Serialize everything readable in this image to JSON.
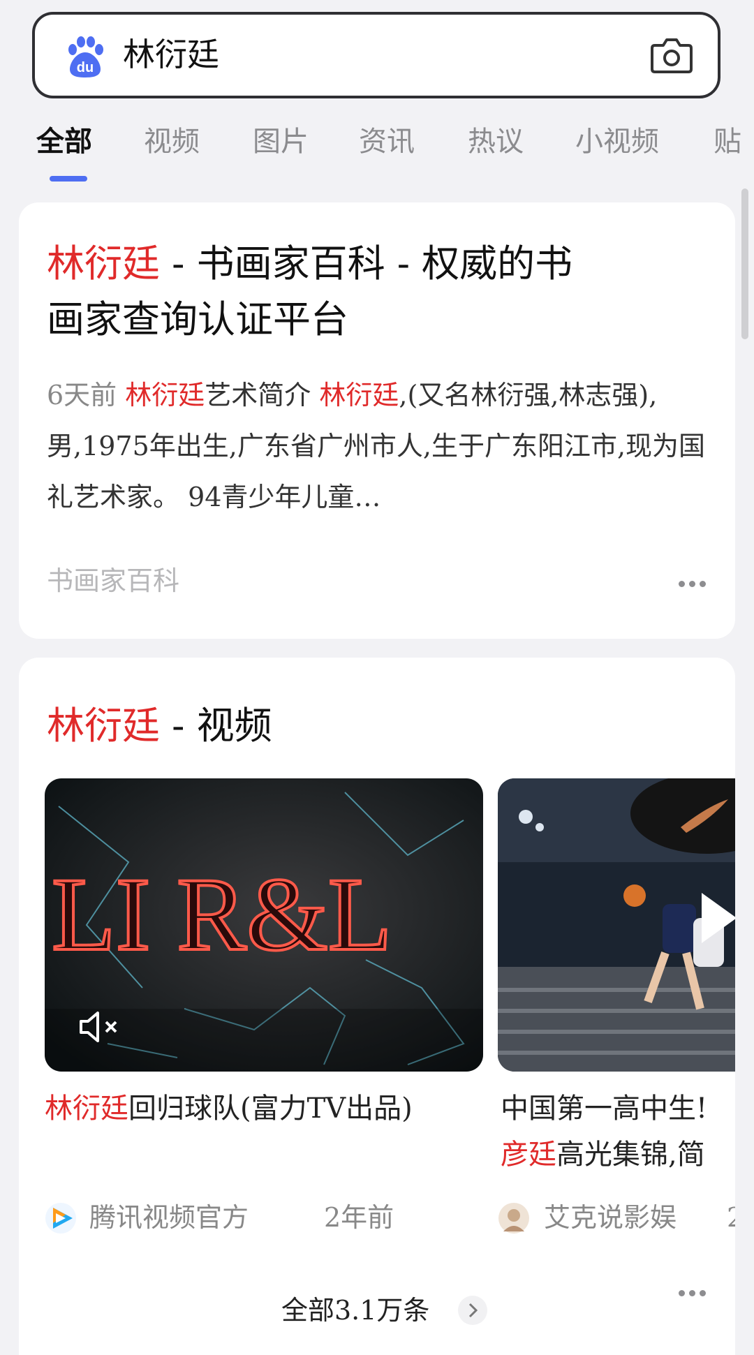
{
  "search": {
    "query": "林衍廷",
    "logo_text": "du"
  },
  "tabs": [
    {
      "label": "全部",
      "active": true
    },
    {
      "label": "视频"
    },
    {
      "label": "图片"
    },
    {
      "label": "资讯"
    },
    {
      "label": "热议"
    },
    {
      "label": "小视频"
    },
    {
      "label": "贴"
    }
  ],
  "result1": {
    "title_hl": "林衍廷",
    "title_rest1": " - 书画家百科 - 权威的书",
    "title_rest2": "画家查询认证平台",
    "date": "6天前",
    "abs_hl1": "林衍廷",
    "abs_t1": "艺术简介",
    "abs_hl2": "林衍廷",
    "abs_t2": ",(又名林衍强,林志强),男,1975年出生,广东省广州市人,生于广东阳江市,现为国礼艺术家。 94青少年儿童…",
    "source": "书画家百科"
  },
  "video_section": {
    "title_hl": "林衍廷",
    "title_rest": " - 视频",
    "thumb1_overlay": "LI R&L",
    "video1": {
      "caption_hl": "林衍廷",
      "caption_rest": "回归球队(富力TV出品)",
      "source": "腾讯视频官方",
      "time": "2年前"
    },
    "video2": {
      "caption_line1": "中国第一高中生!",
      "caption_hl": "彦廷",
      "caption_rest": "高光集锦,简",
      "source": "艾克说影娱",
      "time": "2"
    },
    "all_link": "全部3.1万条"
  },
  "colors": {
    "highlight": "#e02a2a",
    "accent": "#4e6ef2"
  }
}
